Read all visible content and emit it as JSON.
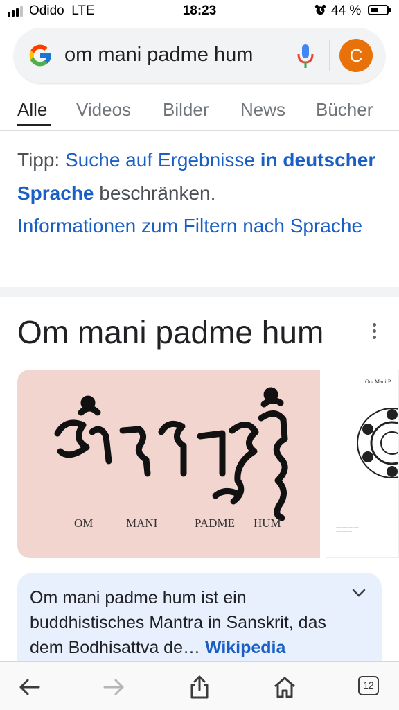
{
  "status_bar": {
    "carrier": "Odido",
    "network": "LTE",
    "time": "18:23",
    "battery_percent": "44 %",
    "battery_level": 0.44
  },
  "search": {
    "query": "om mani padme hum",
    "avatar_letter": "C"
  },
  "tabs": [
    {
      "label": "Alle",
      "active": true
    },
    {
      "label": "Videos",
      "active": false
    },
    {
      "label": "Bilder",
      "active": false
    },
    {
      "label": "News",
      "active": false
    },
    {
      "label": "Bücher",
      "active": false
    }
  ],
  "tip": {
    "prefix": "Tipp:",
    "link_part1": "Suche auf Ergebnisse",
    "link_bold": "in deutscher Sprache",
    "suffix": "beschränken.",
    "info_link": "Informationen zum Filtern nach Sprache"
  },
  "knowledge_panel": {
    "title": "Om mani padme hum",
    "image1_syllables": [
      "OM",
      "MANI",
      "PADME",
      "HUM"
    ],
    "image2_title": "Om Mani P",
    "description": "Om mani padme hum ist ein buddhistisches Mantra in Sanskrit, das dem Bodhisattva de…",
    "source_link": "Wikipedia"
  },
  "toolbar": {
    "tab_count": "12"
  },
  "colors": {
    "link": "#1a5fc3",
    "accent": "#e8710a",
    "card_bg": "#e8f0fe",
    "image_bg": "#f2d5cf"
  },
  "icons": [
    "google-logo-icon",
    "mic-icon",
    "more-vert-icon",
    "chevron-down-icon",
    "back-arrow-icon",
    "forward-arrow-icon",
    "share-icon",
    "home-icon",
    "tabs-icon",
    "alarm-icon"
  ]
}
